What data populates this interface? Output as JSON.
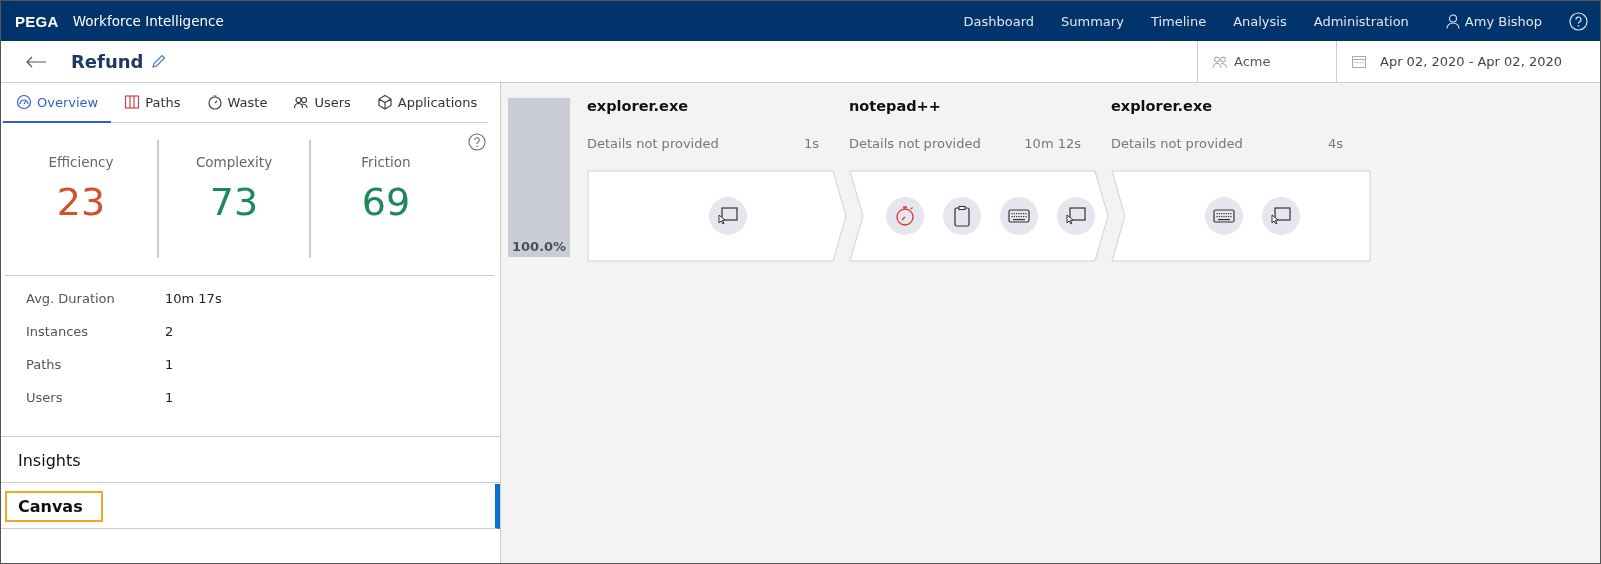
{
  "header": {
    "logo": "PEGA",
    "app_title": "Workforce Intelligence",
    "nav": [
      {
        "label": "Dashboard"
      },
      {
        "label": "Summary"
      },
      {
        "label": "Timeline"
      },
      {
        "label": "Analysis"
      },
      {
        "label": "Administration"
      }
    ],
    "user": "Amy Bishop"
  },
  "subheader": {
    "title": "Refund",
    "organization": "Acme",
    "date_range": "Apr 02, 2020 - Apr 02, 2020"
  },
  "tabs": [
    {
      "label": "Overview",
      "selected": true
    },
    {
      "label": "Paths",
      "selected": false
    },
    {
      "label": "Waste",
      "selected": false
    },
    {
      "label": "Users",
      "selected": false
    },
    {
      "label": "Applications",
      "selected": false
    }
  ],
  "metrics": [
    {
      "label": "Efficiency",
      "value": "23",
      "color": "#d4502a"
    },
    {
      "label": "Complexity",
      "value": "73",
      "color": "#1c8a58"
    },
    {
      "label": "Friction",
      "value": "69",
      "color": "#1c8a58"
    }
  ],
  "stats": [
    {
      "label": "Avg. Duration",
      "value": "10m 17s"
    },
    {
      "label": "Instances",
      "value": "2"
    },
    {
      "label": "Paths",
      "value": "1"
    },
    {
      "label": "Users",
      "value": "1"
    }
  ],
  "sections": [
    {
      "label": "Insights",
      "selected": false,
      "highlighted": false
    },
    {
      "label": "Canvas",
      "selected": true,
      "highlighted": true
    }
  ],
  "path": {
    "share": "100.0%",
    "steps": [
      {
        "title": "explorer.exe",
        "details": "Details not provided",
        "duration": "1s",
        "icons": [
          {
            "kind": "pointer"
          }
        ]
      },
      {
        "title": "notepad++",
        "details": "Details not provided",
        "duration": "10m 12s",
        "icons": [
          {
            "kind": "timer"
          },
          {
            "kind": "clipboard"
          },
          {
            "kind": "keyboard"
          },
          {
            "kind": "pointer"
          }
        ]
      },
      {
        "title": "explorer.exe",
        "details": "Details not provided",
        "duration": "4s",
        "icons": [
          {
            "kind": "keyboard"
          },
          {
            "kind": "pointer"
          }
        ]
      }
    ]
  }
}
